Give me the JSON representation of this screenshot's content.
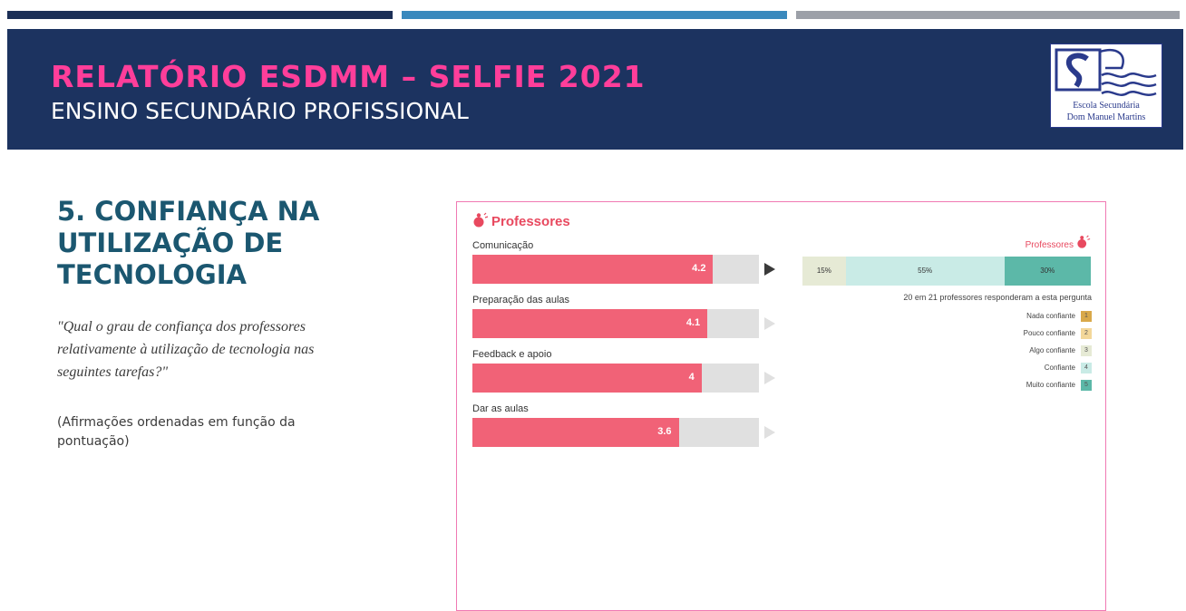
{
  "header": {
    "title": "RELATÓRIO ESDMM – SELFIE 2021",
    "subtitle": "ENSINO SECUNDÁRIO PROFISSIONAL",
    "logo": {
      "line1": "Escola Secundária",
      "line2": "Dom Manuel Martins"
    }
  },
  "section": {
    "title_lines": [
      "5. CONFIANÇA NA",
      "UTILIZAÇÃO DE",
      "TECNOLOGIA"
    ],
    "quote": "\"Qual o grau de confiança dos professores relativamente à utilização de tecnologia nas seguintes tarefas?\"",
    "note": "(Afirmações ordenadas em função da pontuação)"
  },
  "panel": {
    "title": "Professores",
    "dist_label": "Professores",
    "responded": "20 em 21 professores responderam a esta pergunta"
  },
  "colors": {
    "bar": "#f16277",
    "track": "#e0e0e0",
    "accent": "#e8495f",
    "scale": [
      "#d9a94a",
      "#f3d79a",
      "#e6ead5",
      "#c9ebe6",
      "#5cb8a8"
    ]
  },
  "chart_data": [
    {
      "type": "bar",
      "orientation": "horizontal",
      "categories": [
        "Comunicação",
        "Preparação das aulas",
        "Feedback e apoio",
        "Dar as aulas"
      ],
      "values": [
        4.2,
        4.1,
        4,
        3.6
      ],
      "value_labels": [
        "4.2",
        "4.1",
        "4",
        "3.6"
      ],
      "xlim": [
        0,
        5
      ],
      "selected_index": 0
    },
    {
      "type": "bar",
      "stacked": true,
      "series": [
        {
          "name": "Nada confiante",
          "code": "1",
          "value": 0,
          "label": ""
        },
        {
          "name": "Pouco confiante",
          "code": "2",
          "value": 0,
          "label": ""
        },
        {
          "name": "Algo confiante",
          "code": "3",
          "value": 15,
          "label": "15%"
        },
        {
          "name": "Confiante",
          "code": "4",
          "value": 55,
          "label": "55%"
        },
        {
          "name": "Muito confiante",
          "code": "5",
          "value": 30,
          "label": "30%"
        }
      ]
    }
  ]
}
